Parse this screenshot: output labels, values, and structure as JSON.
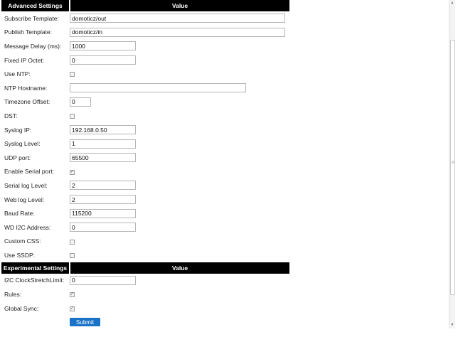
{
  "advanced": {
    "header_left": "Advanced Settings",
    "header_right": "Value",
    "subscribe_template": {
      "label": "Subscribe Template:",
      "value": "domoticz/out"
    },
    "publish_template": {
      "label": "Publish Template:",
      "value": "domoticz/in"
    },
    "message_delay": {
      "label": "Message Delay (ms):",
      "value": "1000"
    },
    "fixed_ip_octet": {
      "label": "Fixed IP Octet:",
      "value": "0"
    },
    "use_ntp": {
      "label": "Use NTP:",
      "checked": false
    },
    "ntp_hostname": {
      "label": "NTP Hostname:",
      "value": ""
    },
    "timezone_offset": {
      "label": "Timezone Offset:",
      "value": "0"
    },
    "dst": {
      "label": "DST:",
      "checked": false
    },
    "syslog_ip": {
      "label": "Syslog IP:",
      "value": "192.168.0.50"
    },
    "syslog_level": {
      "label": "Syslog Level:",
      "value": "1"
    },
    "udp_port": {
      "label": "UDP port:",
      "value": "65500"
    },
    "enable_serial_port": {
      "label": "Enable Serial port:",
      "checked": true
    },
    "serial_log_level": {
      "label": "Serial log Level:",
      "value": "2"
    },
    "web_log_level": {
      "label": "Web log Level:",
      "value": "2"
    },
    "baud_rate": {
      "label": "Baud Rate:",
      "value": "115200"
    },
    "wd_i2c_address": {
      "label": "WD I2C Address:",
      "value": "0"
    },
    "custom_css": {
      "label": "Custom CSS:",
      "checked": false
    },
    "use_ssdp": {
      "label": "Use SSDP:",
      "checked": false
    }
  },
  "experimental": {
    "header_left": "Experimental Settings",
    "header_right": "Value",
    "i2c_clockstretchlimit": {
      "label": "I2C ClockStretchLimit:",
      "value": "0"
    },
    "rules": {
      "label": "Rules:",
      "checked": true
    },
    "global_sync": {
      "label": "Global Sync:",
      "checked": true
    }
  },
  "submit": {
    "label": "Submit"
  },
  "colors": {
    "header_bg": "#000000",
    "header_text": "#ffffff",
    "button": "#1a73c9"
  }
}
